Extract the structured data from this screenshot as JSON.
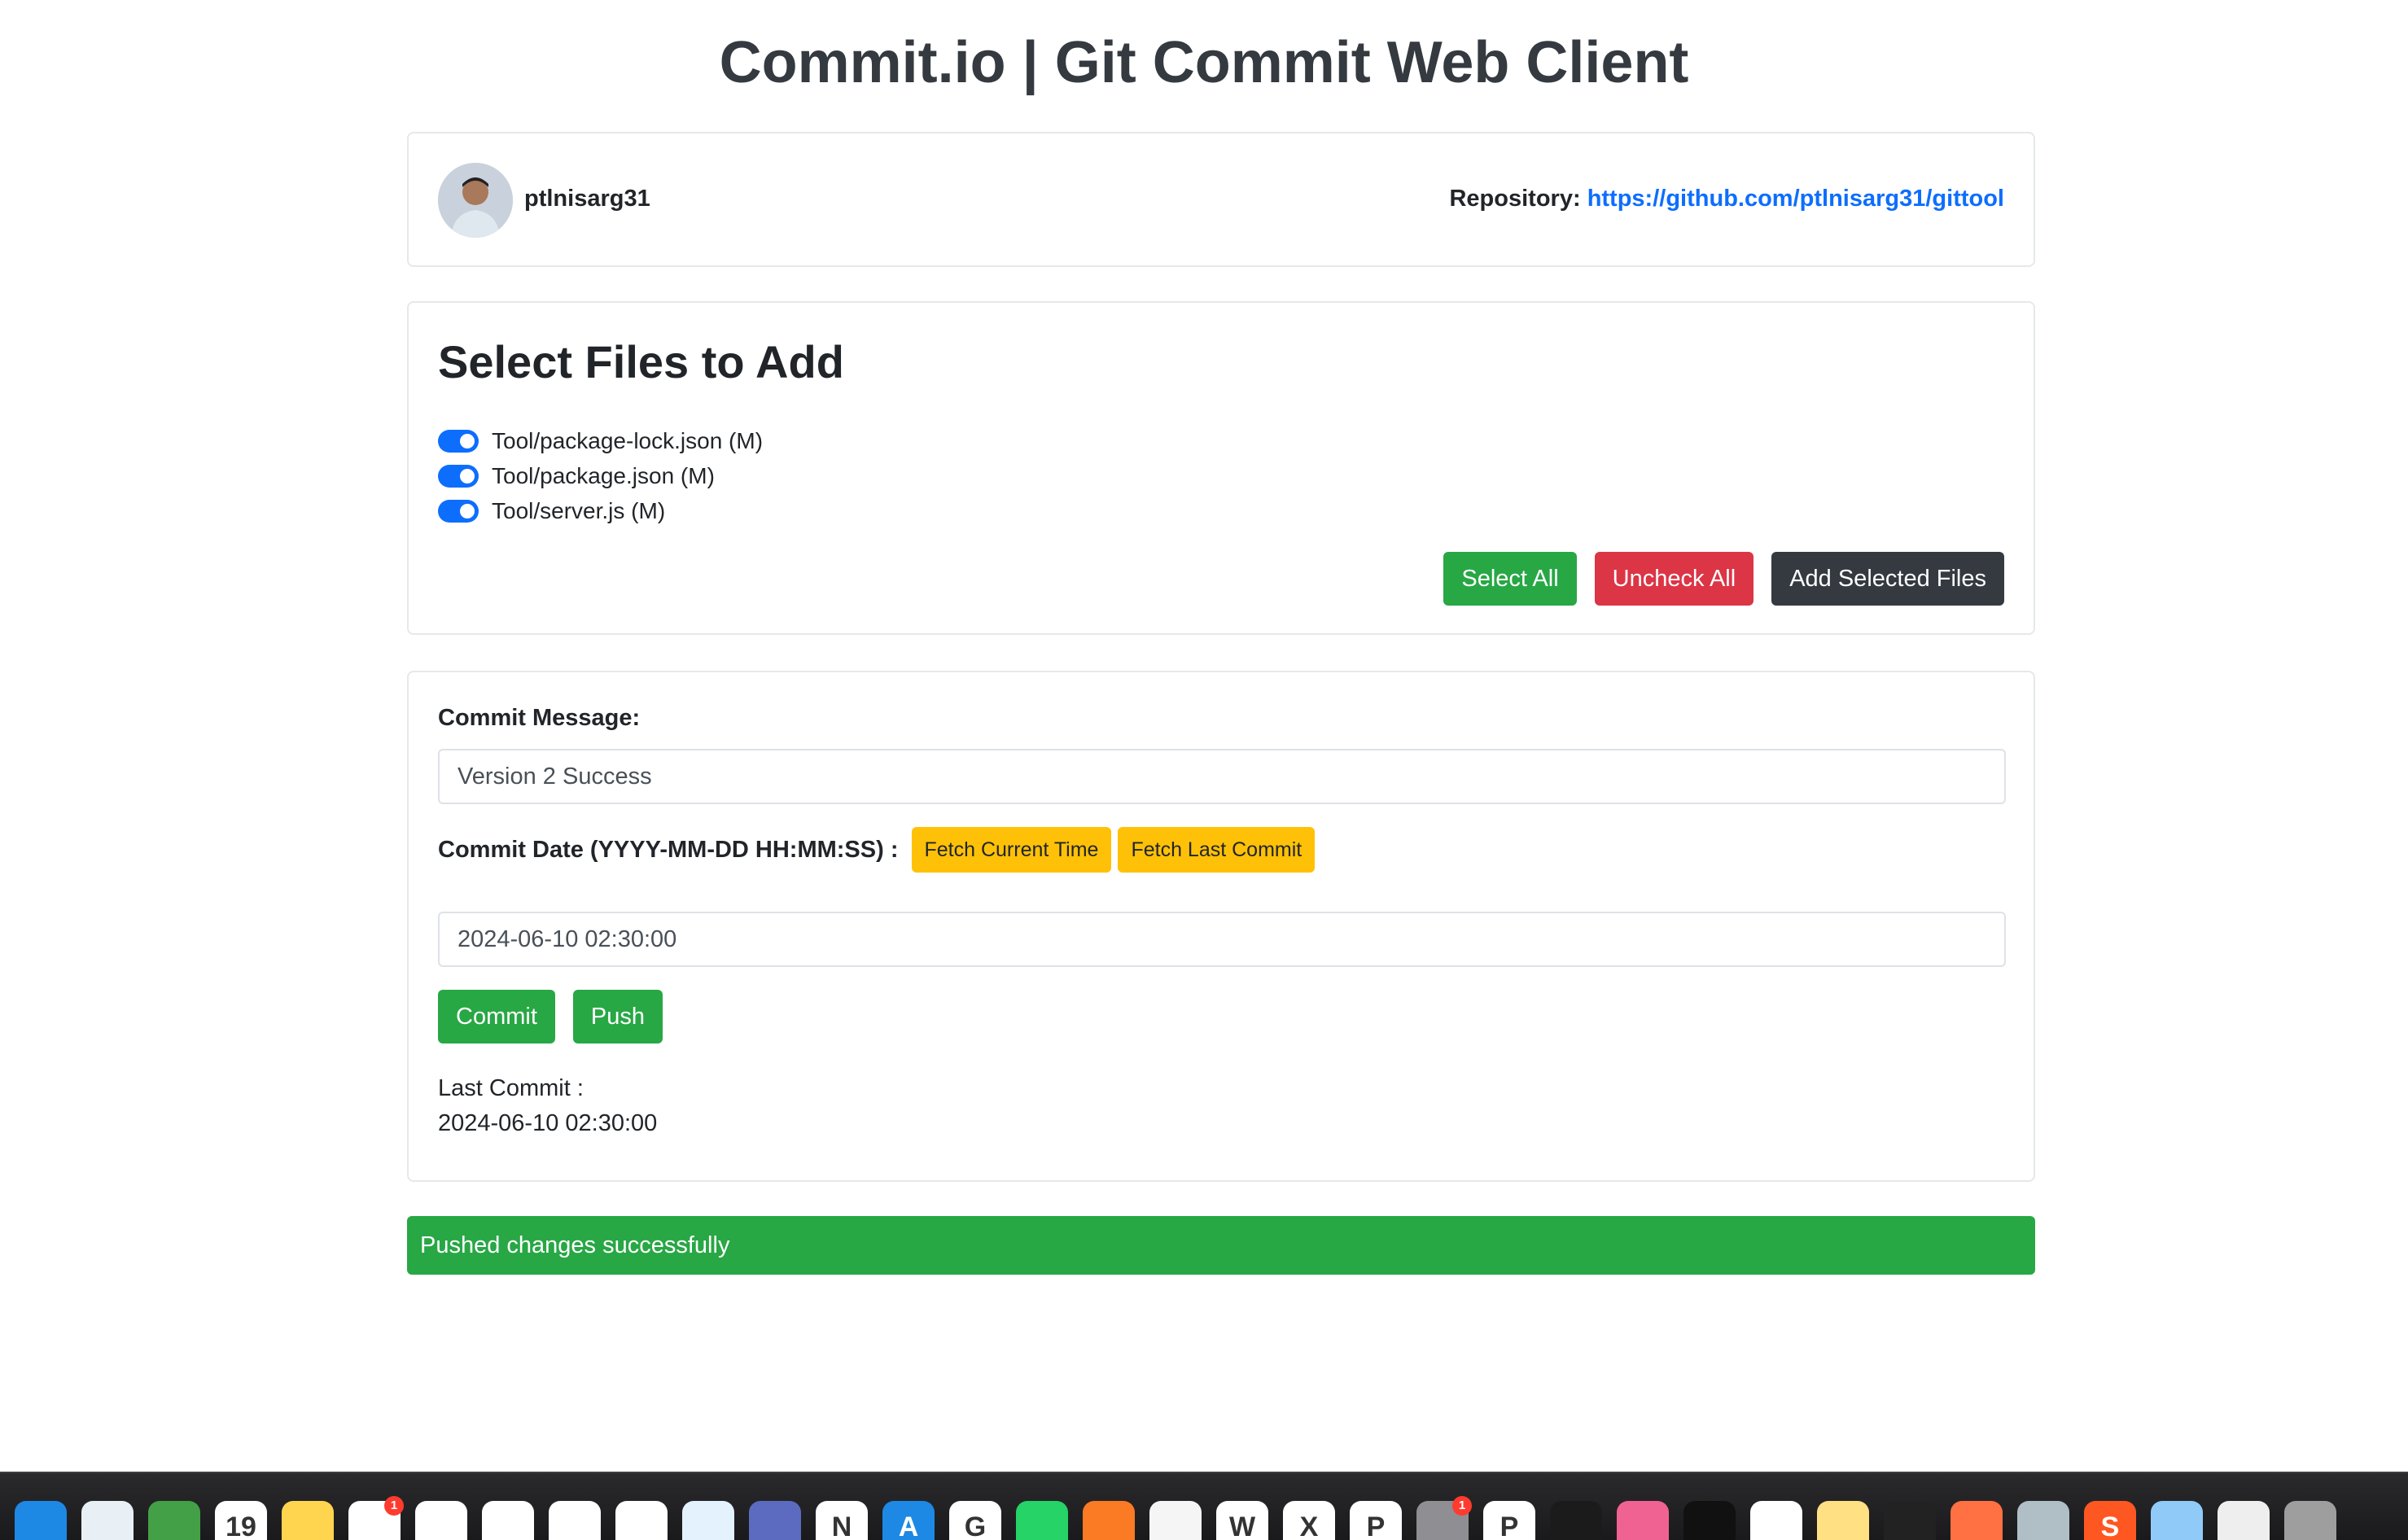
{
  "page": {
    "title": "Commit.io | Git Commit Web Client"
  },
  "user": {
    "username": "ptlnisarg31",
    "repo_label": "Repository:",
    "repo_url": "https://github.com/ptlnisarg31/gittool"
  },
  "files": {
    "title": "Select Files to Add",
    "items": [
      {
        "label": "Tool/package-lock.json (M)",
        "checked": true
      },
      {
        "label": "Tool/package.json (M)",
        "checked": true
      },
      {
        "label": "Tool/server.js (M)",
        "checked": true
      }
    ],
    "select_all": "Select All",
    "uncheck_all": "Uncheck All",
    "add_selected": "Add Selected Files"
  },
  "commit": {
    "message_label": "Commit Message:",
    "message_value": "Version 2 Success",
    "date_label": "Commit Date (YYYY-MM-DD HH:MM:SS) :",
    "fetch_current_time": "Fetch Current Time",
    "fetch_last_commit": "Fetch Last Commit",
    "date_value": "2024-06-10 02:30:00",
    "commit_button": "Commit",
    "push_button": "Push",
    "last_commit_label": "Last Commit :",
    "last_commit_value": "2024-06-10 02:30:00"
  },
  "alert": {
    "text": "Pushed changes successfully"
  },
  "dock": {
    "icons": [
      {
        "name": "safari-icon",
        "color": "#1e88e5",
        "glyph": ""
      },
      {
        "name": "freeform-icon",
        "color": "#e8f0f6",
        "glyph": ""
      },
      {
        "name": "maps-icon",
        "color": "#43a047",
        "glyph": ""
      },
      {
        "name": "calendar-icon",
        "color": "#ffffff",
        "glyph": "19"
      },
      {
        "name": "notes-icon",
        "color": "#ffd54f",
        "glyph": ""
      },
      {
        "name": "reminders-icon",
        "color": "#ffffff",
        "glyph": "",
        "badge": "1"
      },
      {
        "name": "chrome-icon",
        "color": "#ffffff",
        "glyph": ""
      },
      {
        "name": "screenshot-icon",
        "color": "#ffffff",
        "glyph": ""
      },
      {
        "name": "brave-icon",
        "color": "#ffffff",
        "glyph": ""
      },
      {
        "name": "vscode-icon",
        "color": "#ffffff",
        "glyph": ""
      },
      {
        "name": "webstorm-icon",
        "color": "#e3f2fd",
        "glyph": ""
      },
      {
        "name": "teams-icon",
        "color": "#5c6bc0",
        "glyph": ""
      },
      {
        "name": "notion-icon",
        "color": "#ffffff",
        "glyph": "N"
      },
      {
        "name": "app-store-icon",
        "color": "#1e88e5",
        "glyph": "A"
      },
      {
        "name": "google-icon",
        "color": "#ffffff",
        "glyph": "G"
      },
      {
        "name": "whatsapp-icon",
        "color": "#25d366",
        "glyph": ""
      },
      {
        "name": "xampp-icon",
        "color": "#fb7a24",
        "glyph": ""
      },
      {
        "name": "preview-icon",
        "color": "#f5f5f5",
        "glyph": ""
      },
      {
        "name": "word-icon",
        "color": "#ffffff",
        "glyph": "W"
      },
      {
        "name": "excel-icon",
        "color": "#ffffff",
        "glyph": "X"
      },
      {
        "name": "powerpoint-icon",
        "color": "#ffffff",
        "glyph": "P"
      },
      {
        "name": "system-settings-icon",
        "color": "#8e8e93",
        "glyph": "",
        "badge": "1"
      },
      {
        "name": "p-app-icon",
        "color": "#ffffff",
        "glyph": "P"
      },
      {
        "name": "green-app-icon",
        "color": "#1b1b1b",
        "glyph": ""
      },
      {
        "name": "folder-icon",
        "color": "#f06292",
        "glyph": ""
      },
      {
        "name": "terminal-icon",
        "color": "#111111",
        "glyph": ""
      },
      {
        "name": "whatsapp-business-icon",
        "color": "#ffffff",
        "glyph": ""
      },
      {
        "name": "stickies-icon",
        "color": "#ffe082",
        "glyph": ""
      },
      {
        "name": "box-icon",
        "color": "#222222",
        "glyph": ""
      },
      {
        "name": "hand-app-icon",
        "color": "#ff7043",
        "glyph": ""
      },
      {
        "name": "image-capture-icon",
        "color": "#b0bec5",
        "glyph": ""
      },
      {
        "name": "s-app-icon",
        "color": "#ff5722",
        "glyph": "S"
      },
      {
        "name": "documents-icon",
        "color": "#90caf9",
        "glyph": ""
      },
      {
        "name": "file-icon",
        "color": "#eeeeee",
        "glyph": ""
      },
      {
        "name": "trash-icon",
        "color": "#9e9e9e",
        "glyph": ""
      }
    ]
  }
}
